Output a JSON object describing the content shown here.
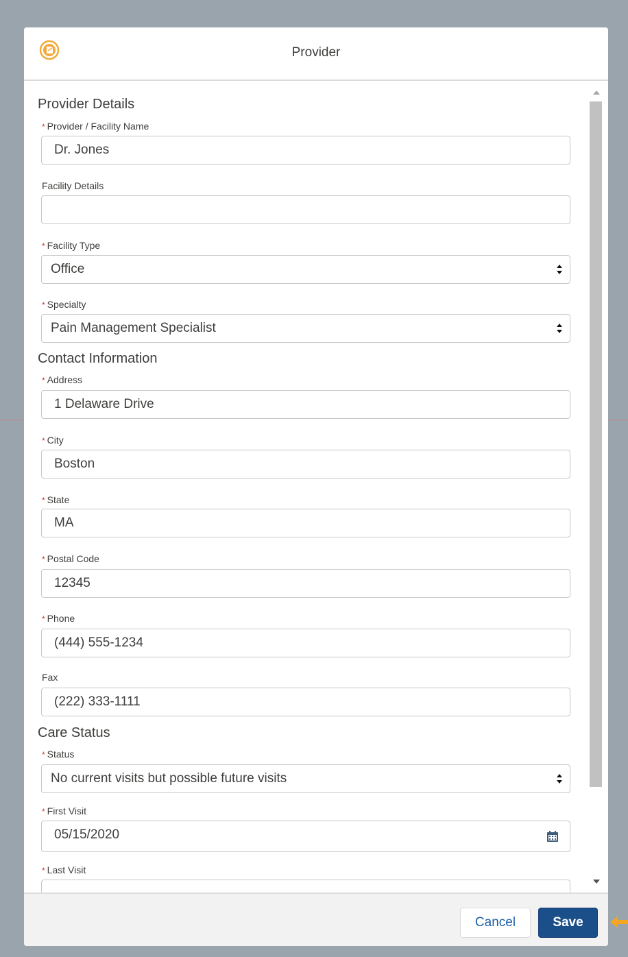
{
  "modal": {
    "title": "Provider"
  },
  "sections": {
    "provider_details": "Provider Details",
    "contact_information": "Contact Information",
    "care_status": "Care Status"
  },
  "fields": {
    "provider_name": {
      "label": "Provider / Facility Name",
      "required": true,
      "value": "Dr. Jones"
    },
    "facility_details": {
      "label": "Facility Details",
      "required": false,
      "value": ""
    },
    "facility_type": {
      "label": "Facility Type",
      "required": true,
      "value": "Office"
    },
    "specialty": {
      "label": "Specialty",
      "required": true,
      "value": "Pain Management Specialist"
    },
    "address": {
      "label": "Address",
      "required": true,
      "value": "1 Delaware Drive"
    },
    "city": {
      "label": "City",
      "required": true,
      "value": "Boston"
    },
    "state": {
      "label": "State",
      "required": true,
      "value": "MA"
    },
    "postal_code": {
      "label": "Postal Code",
      "required": true,
      "value": "12345"
    },
    "phone": {
      "label": "Phone",
      "required": true,
      "value": "(444) 555-1234"
    },
    "fax": {
      "label": "Fax",
      "required": false,
      "value": "(222) 333-1111"
    },
    "status": {
      "label": "Status",
      "required": true,
      "value": "No current visits but possible future visits"
    },
    "first_visit": {
      "label": "First Visit",
      "required": true,
      "value": "05/15/2020"
    },
    "last_visit": {
      "label": "Last Visit",
      "required": true,
      "value": ""
    }
  },
  "footer": {
    "cancel_label": "Cancel",
    "save_label": "Save"
  },
  "colors": {
    "required_marker": "#c23934",
    "save_button": "#1b4f8a",
    "cancel_text": "#1b5fa8",
    "header_icon": "#f2a93b"
  },
  "icons": {
    "header": "provider-record-icon",
    "select": "sort-arrows-icon",
    "date": "calendar-icon",
    "pointer": "arrow-pointer-icon"
  }
}
